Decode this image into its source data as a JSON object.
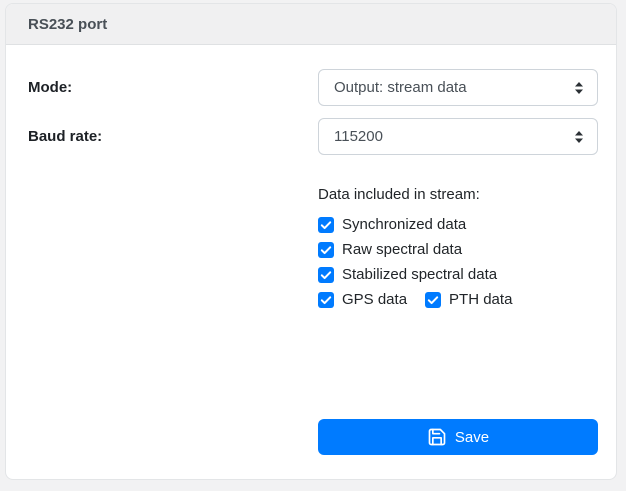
{
  "panel": {
    "title": "RS232 port"
  },
  "form": {
    "mode": {
      "label": "Mode:",
      "value": "Output: stream data"
    },
    "baud_rate": {
      "label": "Baud rate:",
      "value": "115200"
    },
    "stream_section": {
      "label": "Data included in stream:",
      "checkboxes": [
        {
          "label": "Synchronized data",
          "checked": true
        },
        {
          "label": "Raw spectral data",
          "checked": true
        },
        {
          "label": "Stabilized spectral data",
          "checked": true
        },
        {
          "label": "GPS data",
          "checked": true
        },
        {
          "label": "PTH data",
          "checked": true
        }
      ]
    },
    "save_button": {
      "label": "Save",
      "icon": "save-icon"
    }
  },
  "icons": {
    "select_indicator": "updown-arrows-icon",
    "checkbox_checked": "checkmark-icon"
  },
  "colors": {
    "accent_blue": "#007bff",
    "card_background": "#ffffff",
    "header_background": "#f0f0f1",
    "page_background": "#f2f2f3",
    "select_border": "#ced4da",
    "label_text": "#1d2126",
    "header_text": "#495057"
  }
}
